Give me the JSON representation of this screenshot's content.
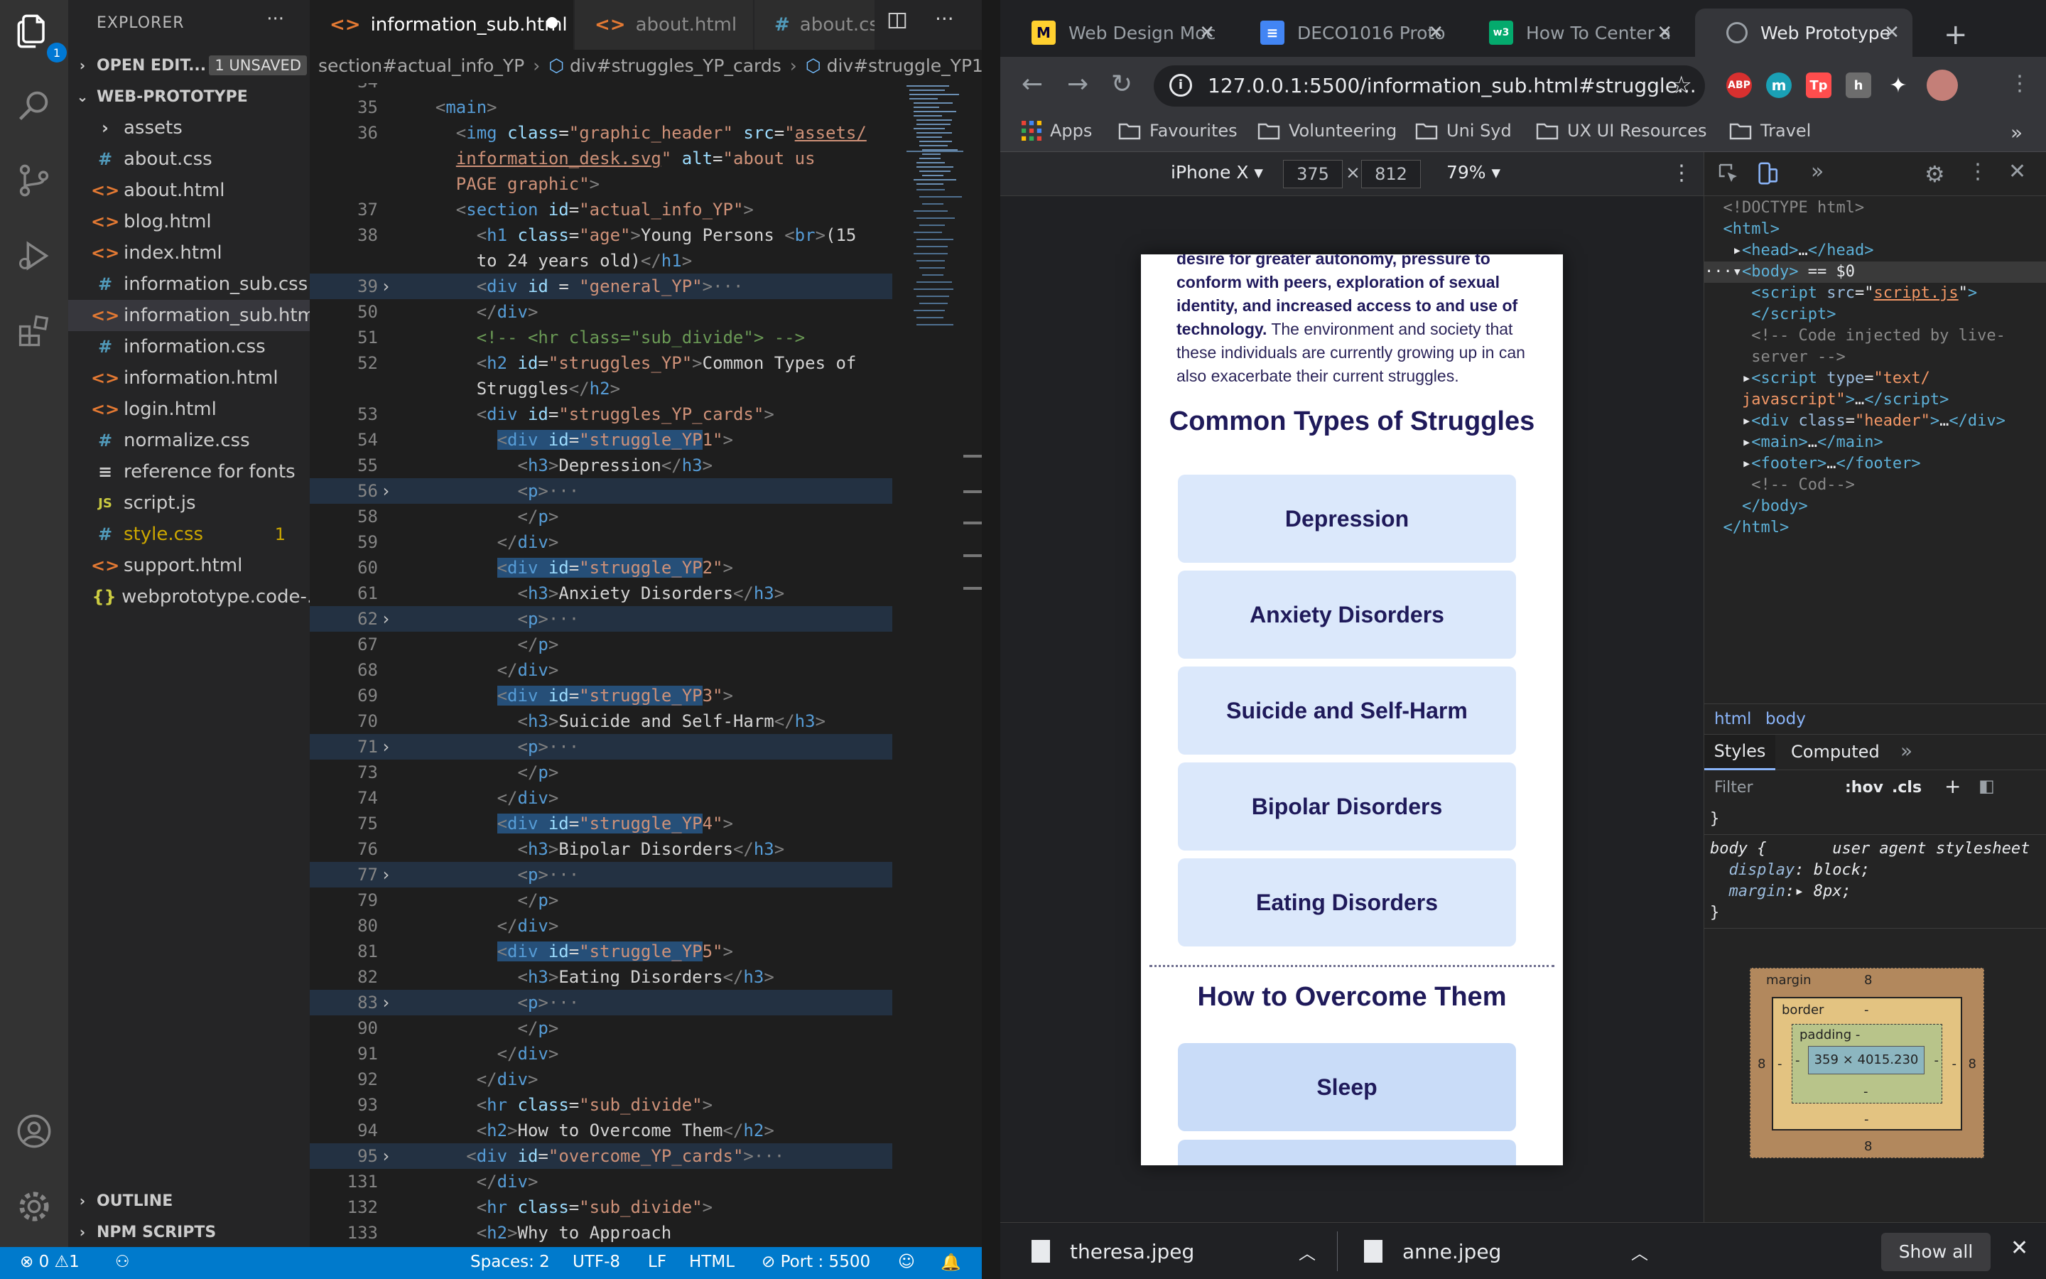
{
  "vscode": {
    "activity_badge": "1",
    "explorer": {
      "header": "EXPLORER",
      "open_editors": "OPEN EDIT...",
      "unsaved": "1 UNSAVED",
      "project": "WEB-PROTOTYPE",
      "files": [
        {
          "name": "assets",
          "type": "folder"
        },
        {
          "name": "about.css",
          "type": "css"
        },
        {
          "name": "about.html",
          "type": "html"
        },
        {
          "name": "blog.html",
          "type": "html"
        },
        {
          "name": "index.html",
          "type": "html"
        },
        {
          "name": "information_sub.css",
          "type": "css"
        },
        {
          "name": "information_sub.html",
          "type": "html",
          "active": true
        },
        {
          "name": "information.css",
          "type": "css"
        },
        {
          "name": "information.html",
          "type": "html"
        },
        {
          "name": "login.html",
          "type": "html"
        },
        {
          "name": "normalize.css",
          "type": "css"
        },
        {
          "name": "reference for fonts",
          "type": "txt"
        },
        {
          "name": "script.js",
          "type": "js"
        },
        {
          "name": "style.css",
          "type": "css",
          "problems": "1"
        },
        {
          "name": "support.html",
          "type": "html"
        },
        {
          "name": "webprototype.code-...",
          "type": "json"
        }
      ],
      "outline": "OUTLINE",
      "npm_scripts": "NPM SCRIPTS"
    },
    "tabs": [
      {
        "label": "information_sub.html",
        "icon": "<>",
        "active": true
      },
      {
        "label": "about.html",
        "icon": "<>"
      },
      {
        "label": "about.cs",
        "icon": "#"
      }
    ],
    "breadcrumb": [
      "section#actual_info_YP",
      "div#struggles_YP_cards",
      "div#struggle_YP1"
    ],
    "status": {
      "errors": "0",
      "warnings": "1",
      "spaces": "Spaces: 2",
      "encoding": "UTF-8",
      "eol": "LF",
      "language": "HTML",
      "port": "Port : 5500"
    }
  },
  "chrome": {
    "tabs": [
      {
        "title": "Web Design Moc",
        "icon": "miro-icon"
      },
      {
        "title": "DECO1016 Proto",
        "icon": "docs-icon"
      },
      {
        "title": "How To Center a",
        "icon": "w3-icon"
      },
      {
        "title": "Web Prototype",
        "icon": "globe-icon",
        "active": true
      }
    ],
    "url": "127.0.0.1:5500/information_sub.html#struggle...",
    "bookmarks": [
      "Apps",
      "Favourites",
      "Volunteering",
      "Uni Syd",
      "UX UI Resources",
      "Travel"
    ],
    "device": {
      "name": "iPhone X",
      "width": "375",
      "height": "812",
      "zoom": "79%"
    },
    "page": {
      "intro_bold1": "desire for greater autonomy, pressure to conform with peers, exploration of sexual identity, and increased access to and use of technology.",
      "intro_rest": " The environment and society that these individuals are currently growing up in can also exacerbate their current struggles.",
      "heading1": "Common Types of Struggles",
      "cards": [
        "Depression",
        "Anxiety Disorders",
        "Suicide and Self-Harm",
        "Bipolar Disorders",
        "Eating Disorders"
      ],
      "heading2": "How to Overcome Them",
      "cards2": [
        "Sleep"
      ]
    },
    "devtools": {
      "crumbs": [
        "html",
        "body"
      ],
      "tabs": [
        "Styles",
        "Computed"
      ],
      "filter": "Filter",
      "hov": ":hov",
      "cls": ".cls",
      "rule_selector": "body {",
      "rule_source": "user agent stylesheet",
      "prop1": "display",
      "val1": "block;",
      "prop2": "margin",
      "val2": "8px;",
      "box": {
        "margin_label": "margin",
        "margin": "8",
        "border_label": "border",
        "border": "-",
        "padding_label": "padding -",
        "content": "359 × 4015.230",
        "dash": "-"
      }
    },
    "downloads": [
      "theresa.jpeg",
      "anne.jpeg"
    ],
    "show_all": "Show all"
  }
}
